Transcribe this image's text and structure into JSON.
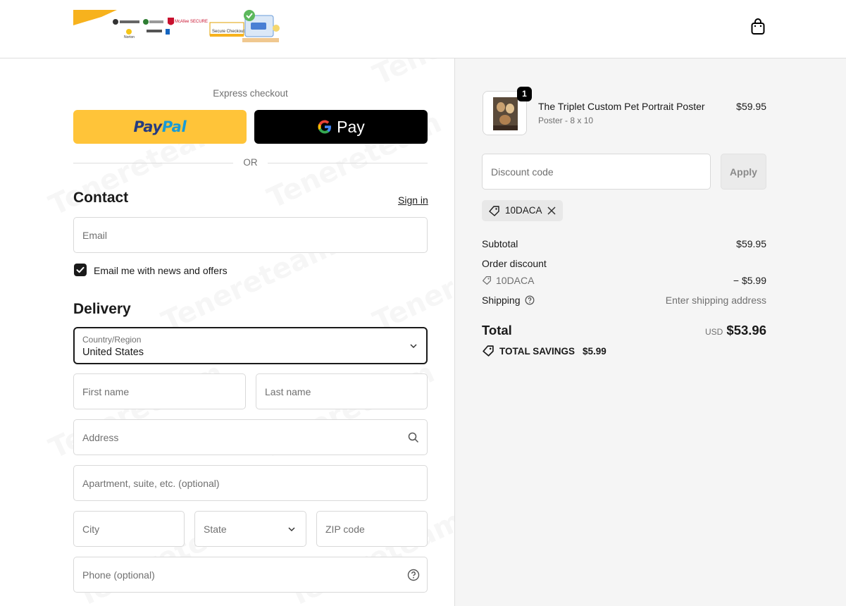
{
  "header": {
    "logo_badges": [
      "Norton",
      "McAfee SECURE",
      "Secure Checkout"
    ]
  },
  "express": {
    "title": "Express checkout",
    "paypal_label_a": "Pay",
    "paypal_label_b": "Pal",
    "gpay_label": "Pay",
    "or_text": "OR"
  },
  "contact": {
    "heading": "Contact",
    "signin_label": "Sign in",
    "email_placeholder": "Email",
    "newsletter_label": "Email me with news and offers",
    "newsletter_checked": true
  },
  "delivery": {
    "heading": "Delivery",
    "country_label": "Country/Region",
    "country_value": "United States",
    "first_name_placeholder": "First name",
    "last_name_placeholder": "Last name",
    "address_placeholder": "Address",
    "apartment_placeholder": "Apartment, suite, etc. (optional)",
    "city_placeholder": "City",
    "state_placeholder": "State",
    "zip_placeholder": "ZIP code",
    "phone_placeholder": "Phone (optional)"
  },
  "summary": {
    "product": {
      "quantity": "1",
      "title": "The Triplet Custom Pet Portrait Poster",
      "variant": "Poster - 8 x 10",
      "price": "$59.95"
    },
    "discount_placeholder": "Discount code",
    "apply_label": "Apply",
    "applied_code": "10DACA",
    "subtotal_label": "Subtotal",
    "subtotal_value": "$59.95",
    "order_discount_label": "Order discount",
    "discount_code_label": "10DACA",
    "discount_value": "− $5.99",
    "shipping_label": "Shipping",
    "shipping_value": "Enter shipping address",
    "total_label": "Total",
    "currency": "USD",
    "total_value": "$53.96",
    "savings_label": "TOTAL SAVINGS",
    "savings_value": "$5.99"
  },
  "watermark": "Tenereteam",
  "colors": {
    "paypal_yellow": "#ffc439",
    "paypal_dark_blue": "#253b80",
    "paypal_light_blue": "#179bd7",
    "gpay_black": "#000000",
    "summary_bg": "#f5f5f5"
  }
}
